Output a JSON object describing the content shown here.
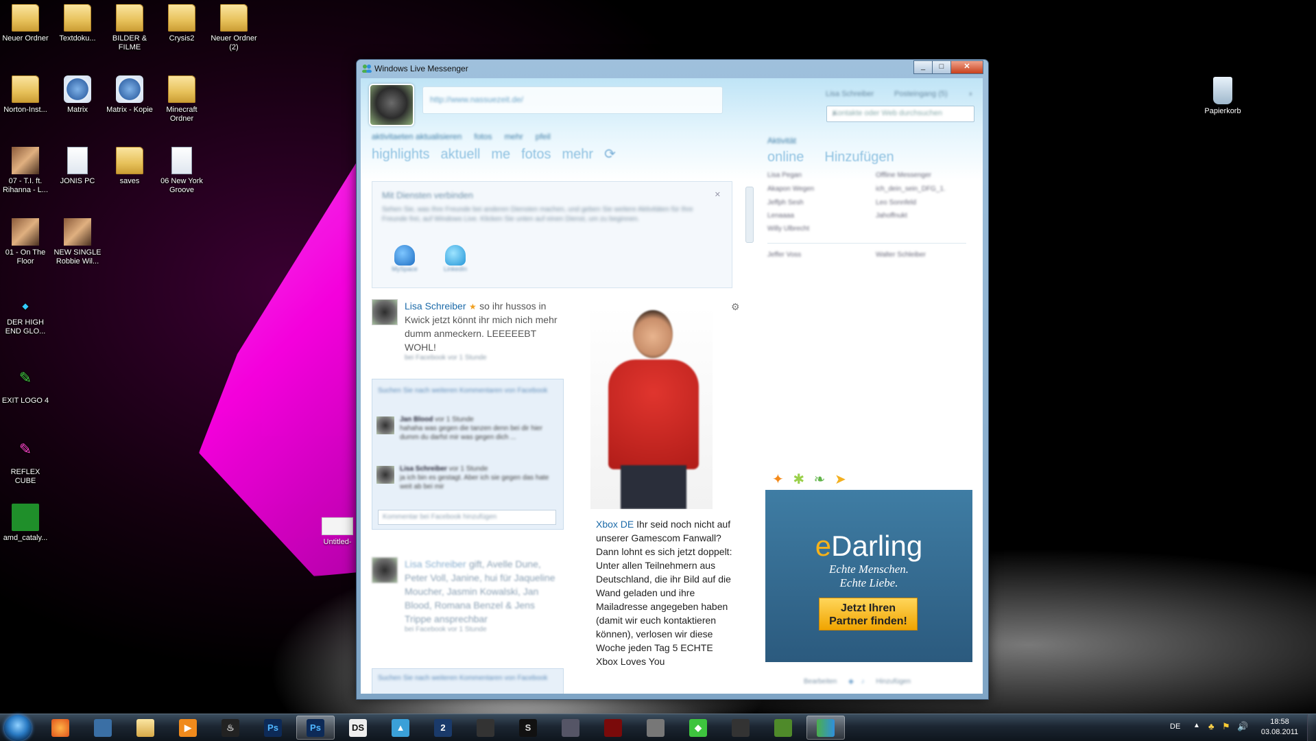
{
  "desktop": {
    "icons": [
      {
        "label": "Neuer Ordner",
        "type": "folder"
      },
      {
        "label": "Textdoku...",
        "type": "folder"
      },
      {
        "label": "BILDER & FILME",
        "type": "folder"
      },
      {
        "label": "Crysis2",
        "type": "folder"
      },
      {
        "label": "Neuer Ordner (2)",
        "type": "folder"
      },
      {
        "label": "Norton-Inst...",
        "type": "folder"
      },
      {
        "label": "Matrix",
        "type": "gear"
      },
      {
        "label": "Matrix - Kopie",
        "type": "gear"
      },
      {
        "label": "Minecraft Ordner",
        "type": "folder"
      },
      {
        "label": "07 - T.I. ft. Rihanna - L...",
        "type": "pic"
      },
      {
        "label": "JONIS PC",
        "type": "file"
      },
      {
        "label": "saves",
        "type": "folder"
      },
      {
        "label": "06 New York Groove",
        "type": "wma"
      },
      {
        "label": "01 - On The Floor",
        "type": "pic"
      },
      {
        "label": "NEW SINGLE Robbie Wil...",
        "type": "pic"
      },
      {
        "label": "DER HIGH END GLO...",
        "type": "app"
      },
      {
        "label": "EXIT LOGO 4",
        "type": "app"
      },
      {
        "label": "REFLEX CUBE",
        "type": "app"
      },
      {
        "label": "amd_cataly...",
        "type": "app"
      },
      {
        "label": "Papierkorb",
        "type": "recycle"
      }
    ],
    "untitled_label": "Untitled-"
  },
  "messenger": {
    "title": "Windows Live Messenger",
    "status_url": "http://www.nassuezeit.de/",
    "header_links": [
      "Lisa Schreiber",
      "Posteingang (5)"
    ],
    "search_placeholder": "Kontakte oder Web durchsuchen",
    "small_tabs": [
      "aktivitaeten aktualisieren",
      "fotos",
      "mehr",
      "pfeil"
    ],
    "tabs": [
      "highlights",
      "aktuell",
      "me",
      "fotos",
      "mehr"
    ],
    "right_small": "Aktivität",
    "right_tabs": [
      "online",
      "Hinzufügen"
    ],
    "connect": {
      "heading": "Mit Diensten verbinden",
      "text": "Sehen Sie, was Ihre Freunde bei anderen Diensten machen, und geben Sie weitere Aktivitäten für Ihre Freunde frei, auf Windows Live. Klicken Sie unten auf einen Dienst, um zu beginnen.",
      "services": [
        "MySpace",
        "LinkedIn"
      ]
    },
    "post1": {
      "author": "Lisa Schreiber",
      "text": "so ihr hussos in Kwick jetzt könnt ihr mich nich mehr dumm anmeckern. LEEEEEBT WOHL!",
      "meta": "bei Facebook vor 1 Stunde"
    },
    "comments_header": "Suchen Sie nach weiteren Kommentaren von Facebook",
    "comments": [
      {
        "author": "Jan Blood",
        "time": "vor 1 Stunde",
        "text": "hahaha was gegen die tanzen denn bei dir hier dumm du darfst mir was gegen dich ..."
      },
      {
        "author": "Lisa Schreiber",
        "time": "vor 1 Stunde",
        "text": "ja ich bin es gestagt. Aber ich sie gegen das hate weit ab bei mir"
      }
    ],
    "comment_input": "Kommentar bei Facebook hinzufügen",
    "xbox": {
      "author": "Xbox DE",
      "text": "Ihr seid noch nicht auf unserer Gamescom Fanwall? Dann lohnt es sich jetzt doppelt: Unter allen Teilnehmern aus Deutschland, die ihr Bild auf die Wand geladen und ihre Mailadresse angegeben haben (damit wir euch kontaktieren können), verlosen wir diese Woche jeden Tag 5 ECHTE Xbox Loves You"
    },
    "post2": {
      "author": "Lisa Schreiber",
      "text": "gift, Avelle Dune, Peter Voll, Janine, hui für Jaqueline Moucher, Jasmin Kowalski, Jan Blood, Romana Benzel & Jens Trippe ansprechbar",
      "meta": "bei Facebook vor 1 Stunde"
    },
    "comments2_header": "Suchen Sie nach weiteren Kommentaren von Facebook",
    "contacts": {
      "col1": [
        "Lisa Pegan",
        "Akapon Wegen",
        "Jeffph Sesh",
        "Lenaaaa",
        "Willy Ulbrecht",
        "Jeffer Voss"
      ],
      "col2": [
        "Offline Messenger",
        "ich_dein_sein_DFG_1.",
        "Leo Sonnfeld",
        "Jahoffnukt",
        "Walter Schleiber"
      ]
    },
    "ad": {
      "brand_e": "e",
      "brand_rest": "Darling",
      "tagline1": "Echte Menschen.",
      "tagline2": "Echte Liebe.",
      "cta_line1": "Jetzt Ihren",
      "cta_line2": "Partner finden!",
      "accent": "#f6b21a"
    },
    "bottom_links": [
      "Bearbeiten",
      "Hinzufügen"
    ]
  },
  "taskbar": {
    "apps": [
      {
        "name": "firefox",
        "glyph": "🦊"
      },
      {
        "name": "computer",
        "glyph": "🖥"
      },
      {
        "name": "explorer",
        "glyph": "📁"
      },
      {
        "name": "media-player",
        "glyph": "▶"
      },
      {
        "name": "steam",
        "glyph": "♨"
      },
      {
        "name": "photoshop-1",
        "glyph": "Ps"
      },
      {
        "name": "photoshop-2",
        "glyph": "Ps"
      },
      {
        "name": "ds",
        "glyph": "DS"
      },
      {
        "name": "blender",
        "glyph": "▲"
      },
      {
        "name": "ds2",
        "glyph": "2"
      },
      {
        "name": "game-1",
        "glyph": "☗"
      },
      {
        "name": "game-2",
        "glyph": "S"
      },
      {
        "name": "game-3",
        "glyph": "⚔"
      },
      {
        "name": "game-4",
        "glyph": "●"
      },
      {
        "name": "game-5",
        "glyph": "⚙"
      },
      {
        "name": "sims",
        "glyph": "◆"
      },
      {
        "name": "game-6",
        "glyph": "🏍"
      },
      {
        "name": "minecraft",
        "glyph": "■"
      },
      {
        "name": "messenger",
        "glyph": "👥"
      }
    ],
    "lang": "DE",
    "time": "18:58",
    "date": "03.08.2011"
  }
}
